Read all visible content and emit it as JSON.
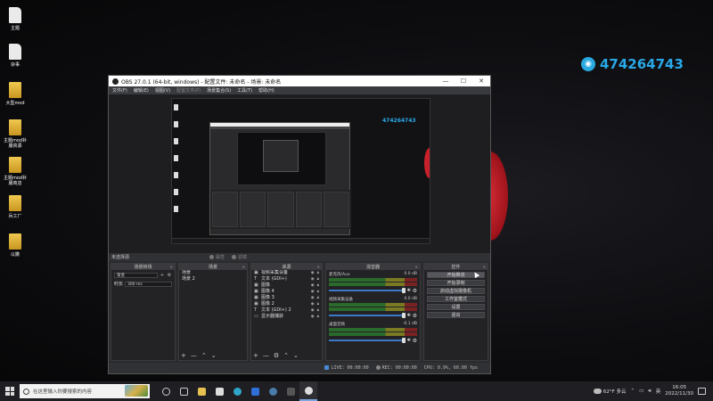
{
  "desktop": {
    "icons": [
      {
        "label": "主题",
        "kind": "file"
      },
      {
        "label": "杂事",
        "kind": "file"
      },
      {
        "label": "大型mod",
        "kind": "folder"
      },
      {
        "label": "主题mod补\n服资源",
        "kind": "folder"
      },
      {
        "label": "主题mod补\n服商店",
        "kind": "folder"
      },
      {
        "label": "兵工厂",
        "kind": "folder"
      },
      {
        "label": "以撒",
        "kind": "folder"
      }
    ],
    "qq_number": "474264743"
  },
  "obs": {
    "title": "OBS 27.0.1 (64-bit, windows) - 配置文件: 未命名 - 场景: 未命名",
    "window_controls": [
      "—",
      "☐",
      "✕"
    ],
    "menu": [
      "文件(F)",
      "编辑(E)",
      "视图(V)",
      "配置文件(P)",
      "场景集合(S)",
      "工具(T)",
      "帮助(H)"
    ],
    "preview_qq": "474264743",
    "scene_bar": {
      "no_source": "未选择源",
      "properties": "属性",
      "filters": "滤镜"
    },
    "transitions": {
      "header": "场景转场",
      "selected": "渐变",
      "duration_label": "时长",
      "duration_value": "300 ms"
    },
    "scenes": {
      "header": "场景",
      "items": [
        "场景",
        "场景 2"
      ]
    },
    "sources": {
      "header": "来源",
      "items": [
        {
          "icon": "▣",
          "name": "视频采集设备"
        },
        {
          "icon": "T",
          "name": "文本 (GDI+)"
        },
        {
          "icon": "▣",
          "name": "图像"
        },
        {
          "icon": "▣",
          "name": "图像 4"
        },
        {
          "icon": "▣",
          "name": "图像 3"
        },
        {
          "icon": "▣",
          "name": "图像 2"
        },
        {
          "icon": "T",
          "name": "文本 (GDI+) 2"
        },
        {
          "icon": "▭",
          "name": "显示器捕获"
        }
      ]
    },
    "mixer": {
      "header": "混音器",
      "channels": [
        {
          "name": "麦克风/Aux",
          "db": "0.0 dB"
        },
        {
          "name": "视频采集设备",
          "db": "0.0 dB"
        },
        {
          "name": "桌面音频",
          "db": "-0.1 dB"
        }
      ]
    },
    "controls": {
      "header": "控件",
      "buttons": [
        "开始推流",
        "开始录制",
        "启动虚拟摄像机",
        "工作室模式",
        "设置",
        "退出"
      ]
    },
    "status": {
      "live": "LIVE: 00:00:00",
      "rec": "REC: 00:00:00",
      "cpu": "CPU: 0.9%, 60.00 fps"
    }
  },
  "taskbar": {
    "search_placeholder": "在这里输入你要搜索的内容",
    "weather": "62°F 多云",
    "lang": "英",
    "time": "16:05",
    "date": "2022/11/30"
  }
}
